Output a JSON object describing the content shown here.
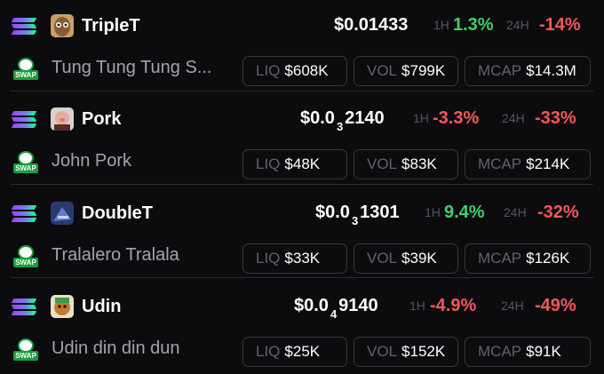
{
  "tokens": [
    {
      "symbol": "TripleT",
      "name": "Tung Tung Tung S...",
      "price_prefix": "$0.01433",
      "price_zero_count": "",
      "price_digits": "",
      "h1_label": "1H",
      "h1_change": "1.3%",
      "h24_label": "24H",
      "h24_change": "-14%",
      "liq_label": "LIQ",
      "liq": "$608K",
      "vol_label": "VOL",
      "vol": "$799K",
      "mcap_label": "MCAP",
      "mcap": "$14.3M",
      "swap_label": "SWAP"
    },
    {
      "symbol": "Pork",
      "name": "John Pork",
      "price_prefix": "$0.0",
      "price_zero_count": "3",
      "price_digits": "2140",
      "h1_label": "1H",
      "h1_change": "-3.3%",
      "h24_label": "24H",
      "h24_change": "-33%",
      "liq_label": "LIQ",
      "liq": "$48K",
      "vol_label": "VOL",
      "vol": "$83K",
      "mcap_label": "MCAP",
      "mcap": "$214K",
      "swap_label": "SWAP"
    },
    {
      "symbol": "DoubleT",
      "name": "Tralalero Tralala",
      "price_prefix": "$0.0",
      "price_zero_count": "3",
      "price_digits": "1301",
      "h1_label": "1H",
      "h1_change": "9.4%",
      "h24_label": "24H",
      "h24_change": "-32%",
      "liq_label": "LIQ",
      "liq": "$33K",
      "vol_label": "VOL",
      "vol": "$39K",
      "mcap_label": "MCAP",
      "mcap": "$126K",
      "swap_label": "SWAP"
    },
    {
      "symbol": "Udin",
      "name": "Udin din din dun",
      "price_prefix": "$0.0",
      "price_zero_count": "4",
      "price_digits": "9140",
      "h1_label": "1H",
      "h1_change": "-4.9%",
      "h24_label": "24H",
      "h24_change": "-49%",
      "liq_label": "LIQ",
      "liq": "$25K",
      "vol_label": "VOL",
      "vol": "$152K",
      "mcap_label": "MCAP",
      "mcap": "$91K",
      "swap_label": "SWAP"
    }
  ],
  "colors": {
    "up": "#3ecf6a",
    "down": "#f0585a",
    "background": "#0c0c0f"
  },
  "icons": {
    "chain": "solana-icon",
    "swap": "swap-icon"
  }
}
